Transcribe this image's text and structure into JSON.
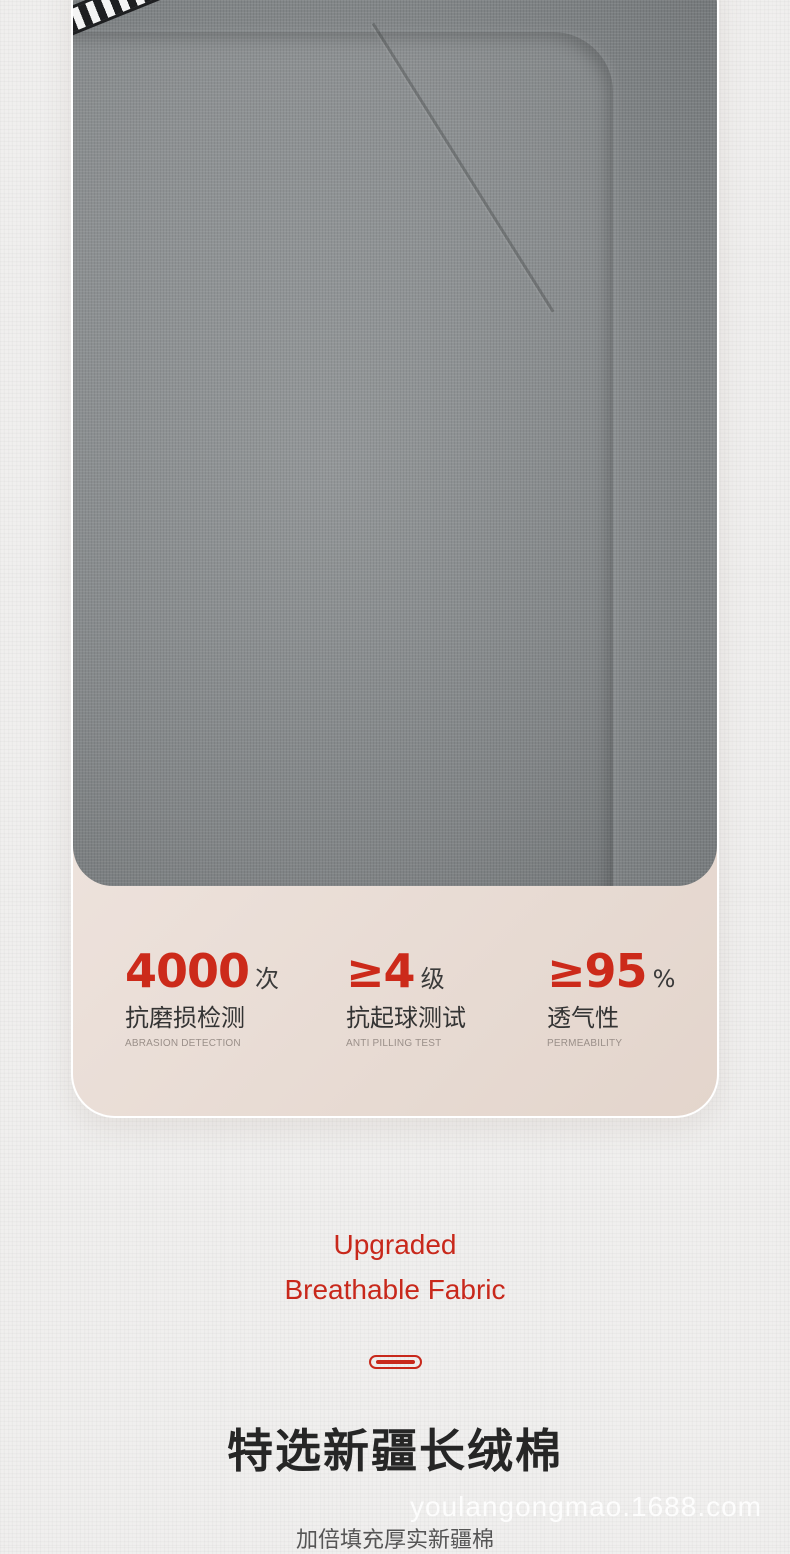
{
  "stats": [
    {
      "value": "4000",
      "unit": "次",
      "label": "抗磨损检测",
      "sublabel": "ABRASION DETECTION"
    },
    {
      "value": "≥4",
      "unit": "级",
      "label": "抗起球测试",
      "sublabel": "ANTI PILLING TEST"
    },
    {
      "value": "≥95",
      "unit": "%",
      "label": "透气性",
      "sublabel": "PERMEABILITY"
    }
  ],
  "headline": {
    "line1": "Upgraded",
    "line2": "Breathable Fabric"
  },
  "section": {
    "title": "特选新疆长绒棉",
    "subtitle": "加倍填充厚实新疆棉"
  },
  "watermark": "youlangongmao.1688.com",
  "colors": {
    "accent": "#c8281b",
    "card_background": "#eee3dd",
    "fabric": "#8a8d8f"
  }
}
